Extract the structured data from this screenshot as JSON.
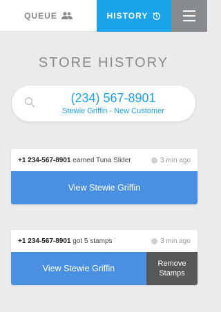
{
  "nav": {
    "queue_label": "QUEUE",
    "history_label": "HISTORY",
    "queue_icon": "people-icon",
    "history_icon": "history-clock-icon",
    "menu_icon": "hamburger-icon"
  },
  "page": {
    "title": "STORE HISTORY"
  },
  "search": {
    "phone": "(234) 567-8901",
    "customer": "Stewie Griffin - New Customer",
    "icon": "search-icon"
  },
  "events": [
    {
      "phone": "+1 234-567-8901",
      "action": "earned Tuna Slider",
      "time": "3 min ago",
      "view_label": "View Stewie Griffin"
    },
    {
      "phone": "+1 234-567-8901",
      "action": "got 5 stamps",
      "time": "3 min ago",
      "view_label": "View Stewie Griffin",
      "remove_label": "Remove Stamps"
    }
  ],
  "colors": {
    "accent": "#1aa3e8",
    "button_blue": "#4a90e2",
    "button_dark": "#575757",
    "menu_gray": "#888b8d",
    "background": "#ebebeb"
  }
}
